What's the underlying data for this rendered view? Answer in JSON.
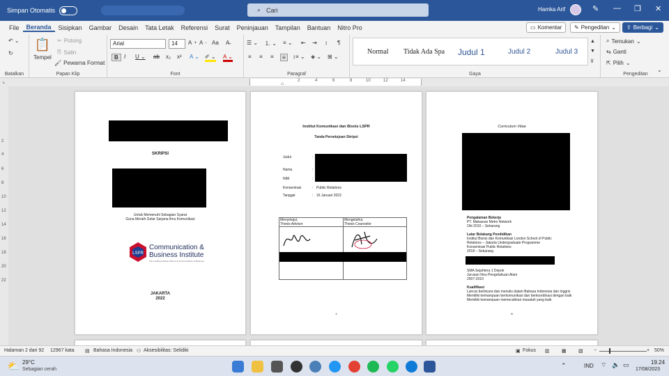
{
  "titlebar": {
    "autosave_label": "Simpan Otomatis",
    "search_placeholder": "Cari",
    "user_name": "Hamka Arif"
  },
  "menu": {
    "items": [
      "File",
      "Beranda",
      "Sisipkan",
      "Gambar",
      "Desain",
      "Tata Letak",
      "Referensi",
      "Surat",
      "Peninjauan",
      "Tampilan",
      "Bantuan",
      "Nitro Pro"
    ],
    "comment_label": "Komentar",
    "editing_label": "Pengeditan",
    "share_label": "Berbagi"
  },
  "ribbon": {
    "undo_group": "Batalkan",
    "clipboard": {
      "paste": "Tempel",
      "cut": "Potong",
      "copy": "Salin",
      "format_painter": "Pewarna Format",
      "label": "Papan Klip"
    },
    "font": {
      "name": "Arial",
      "size": "14",
      "label": "Font"
    },
    "paragraph_label": "Paragraf",
    "styles": {
      "items": [
        "Normal",
        "Tidak Ada Spa",
        "Judul 1",
        "Judul 2",
        "Judul 3"
      ],
      "label": "Gaya"
    },
    "editing": {
      "find": "Temukan",
      "replace": "Ganti",
      "select": "Pilih",
      "label": "Pengeditan"
    }
  },
  "ruler": {
    "ticks": [
      "2",
      "4",
      "6",
      "8",
      "10",
      "12",
      "14"
    ]
  },
  "vruler": {
    "ticks": [
      "2",
      "4",
      "6",
      "8",
      "10",
      "12",
      "14",
      "16",
      "18",
      "20",
      "22"
    ]
  },
  "page1": {
    "title": "SKRIPSI",
    "purpose_line1": "Untuk Memenuhi Sebagian Syarat",
    "purpose_line2": "Guna Meraih Gelar Sarjana Ilmu Komunikasi",
    "logo_line1": "Communication &",
    "logo_line2": "Business Institute",
    "logo_tag": "The Leading Institute School of Communication & Business",
    "city": "JAKARTA",
    "year": "2022"
  },
  "page2": {
    "institution": "Institut Komunikasi dan Bisnis LSPR",
    "subtitle": "Tanda Persetujuan Skripsi",
    "field_judul": "Judul",
    "field_nama": "Nama",
    "field_nim": "NIM",
    "field_konsentrasi": "Konsentrasi",
    "konsentrasi_value": "Public Relations",
    "field_tanggal": "Tanggal",
    "tanggal_value": "16 Januari 2022",
    "approve_label": "Menyetujui,",
    "approve_role": "Thesis Advisor",
    "know_label": "Mengetahui,",
    "know_role": "Thesis Counselor",
    "page_num": "ii"
  },
  "page3": {
    "title": "Curriculum Vitae",
    "work_head": "Pengalaman Bekerja",
    "work_line1": "PT. Makassar Metro Network",
    "work_line2": "Okt 2010 – Sekarang",
    "edu_head": "Latar Belakang Pendidikan",
    "edu_line1": "Institut Bisnis dan Komunikasi London School of Public",
    "edu_line2": "Relations – Jakarta Undergraduate Programme",
    "edu_line3": "Konsentrasi Public Relations",
    "edu_line4": "2018 – Sekarang",
    "sma_line1": "SMA Sejahtera 1 Depok",
    "sma_line2": "Jurusan Ilmu Pengetahuan Alam",
    "sma_line3": "2007-2010",
    "qual_head": "Kualifikasi",
    "qual_line1": "Lancar berbicara dan menulis dalam Bahasa Indonesia dan Inggris",
    "qual_line2": "Memiliki kemampuan berkomunikasi dan berkoordinasi dengan baik",
    "qual_line3": "Memiliki kemampuan memecahkan masalah yang baik",
    "page_num": "iii"
  },
  "status": {
    "page": "Halaman 2 dari 92",
    "words": "12967 kata",
    "language": "Bahasa Indonesia",
    "accessibility": "Aksesibilitas: Selidiki",
    "focus": "Fokus",
    "zoom": "50%"
  },
  "taskbar": {
    "temp": "29°C",
    "weather": "Sebagian cerah",
    "lang": "IND",
    "time": "19.24",
    "date": "17/08/2023"
  }
}
